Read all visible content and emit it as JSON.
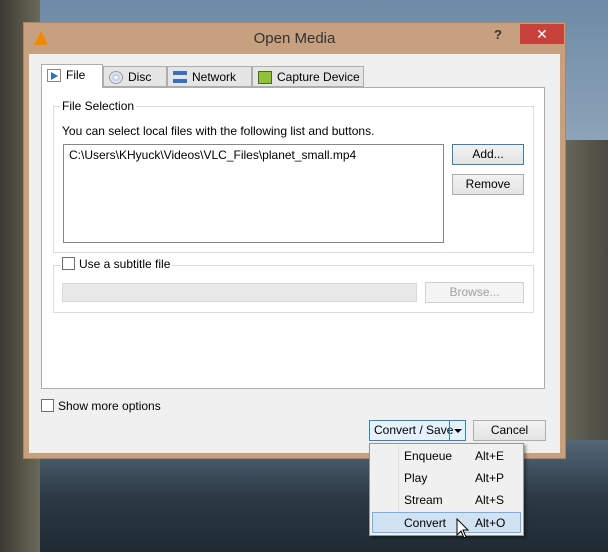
{
  "window": {
    "title": "Open Media",
    "help": "?",
    "close": "✕"
  },
  "tabs": [
    {
      "label": "File",
      "icon": "file-play-icon"
    },
    {
      "label": "Disc",
      "icon": "disc-icon"
    },
    {
      "label": "Network",
      "icon": "network-icon"
    },
    {
      "label": "Capture Device",
      "icon": "capture-card-icon"
    }
  ],
  "file_selection": {
    "title": "File Selection",
    "hint": "You can select local files with the following list and buttons.",
    "files": [
      "C:\\Users\\KHyuck\\Videos\\VLC_Files\\planet_small.mp4"
    ],
    "add": "Add...",
    "remove": "Remove"
  },
  "subtitle": {
    "label": "Use a subtitle file",
    "checked": false,
    "path": "",
    "browse": "Browse..."
  },
  "show_more": {
    "label": "Show more options",
    "checked": false
  },
  "footer": {
    "convert_save": "Convert / Save",
    "cancel": "Cancel"
  },
  "menu": [
    {
      "label": "Enqueue",
      "shortcut": "Alt+E"
    },
    {
      "label": "Play",
      "shortcut": "Alt+P"
    },
    {
      "label": "Stream",
      "shortcut": "Alt+S"
    },
    {
      "label": "Convert",
      "shortcut": "Alt+O",
      "highlighted": true
    }
  ]
}
